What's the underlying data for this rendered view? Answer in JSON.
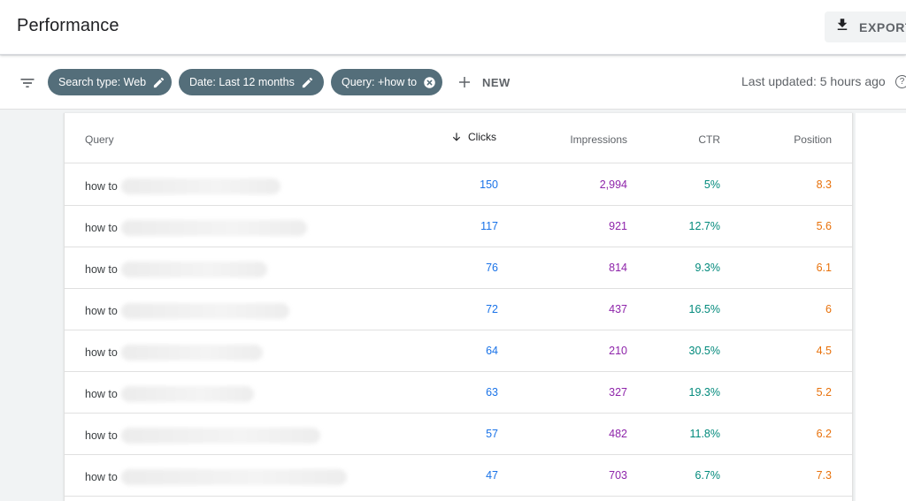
{
  "header": {
    "title": "Performance",
    "export_label": "EXPORT"
  },
  "filters": {
    "chips": [
      {
        "label": "Search type: Web",
        "icon": "pencil-icon"
      },
      {
        "label": "Date: Last 12 months",
        "icon": "pencil-icon"
      },
      {
        "label": "Query: +how to",
        "icon": "close-circle-icon"
      }
    ],
    "new_label": "NEW",
    "last_updated": "Last updated: 5 hours ago",
    "help_glyph": "?"
  },
  "table": {
    "columns": {
      "query": "Query",
      "clicks": "Clicks",
      "impressions": "Impressions",
      "ctr": "CTR",
      "position": "Position"
    },
    "sort": {
      "column": "Clicks",
      "direction": "descending"
    },
    "rows": [
      {
        "query": "how to",
        "clicks": "150",
        "impressions": "2,994",
        "ctr": "5%",
        "position": "8.3"
      },
      {
        "query": "how to",
        "clicks": "117",
        "impressions": "921",
        "ctr": "12.7%",
        "position": "5.6"
      },
      {
        "query": "how to",
        "clicks": "76",
        "impressions": "814",
        "ctr": "9.3%",
        "position": "6.1"
      },
      {
        "query": "how to",
        "clicks": "72",
        "impressions": "437",
        "ctr": "16.5%",
        "position": "6"
      },
      {
        "query": "how to",
        "clicks": "64",
        "impressions": "210",
        "ctr": "30.5%",
        "position": "4.5"
      },
      {
        "query": "how to",
        "clicks": "63",
        "impressions": "327",
        "ctr": "19.3%",
        "position": "5.2"
      },
      {
        "query": "how to",
        "clicks": "57",
        "impressions": "482",
        "ctr": "11.8%",
        "position": "6.2"
      },
      {
        "query": "how to",
        "clicks": "47",
        "impressions": "703",
        "ctr": "6.7%",
        "position": "7.3"
      }
    ]
  },
  "colors": {
    "chip": "#546e7a",
    "clicks": "#1a73e8",
    "impressions": "#8e24aa",
    "ctr": "#00897b",
    "position": "#e8710a"
  }
}
